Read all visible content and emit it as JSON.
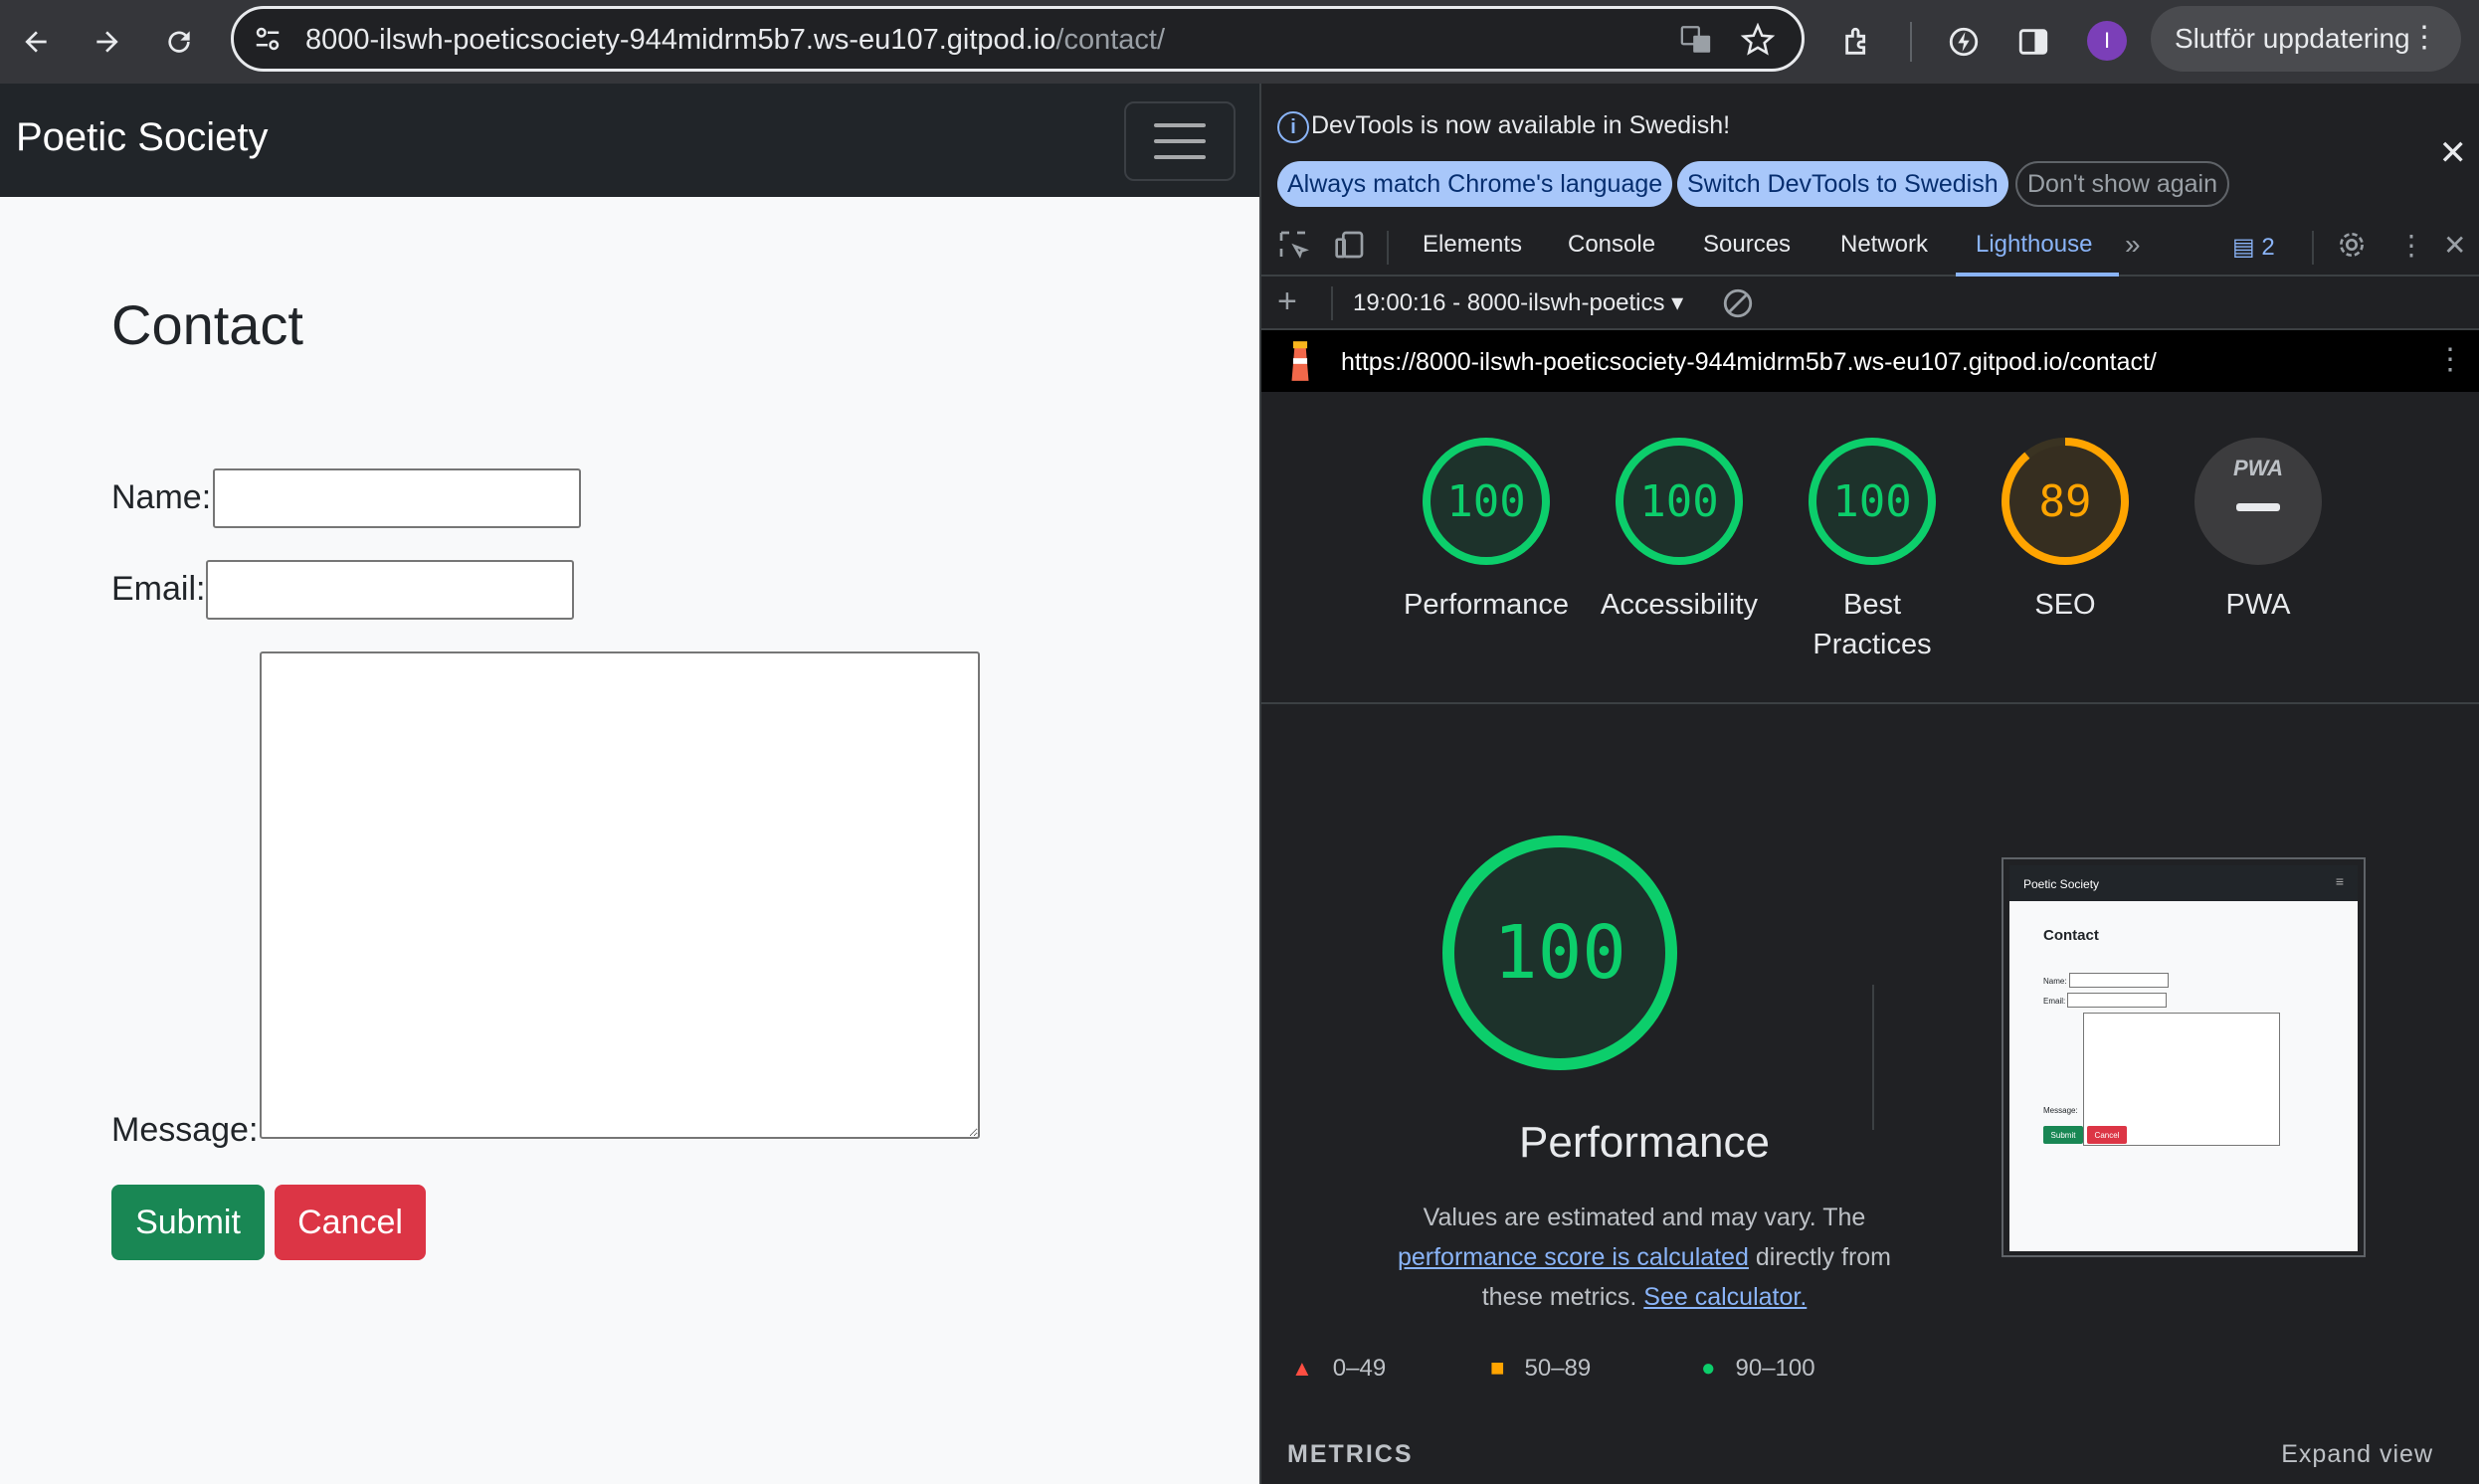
{
  "browser": {
    "url_host": "8000-ilswh-poeticsociety-944midrm5b7.ws-eu107.gitpod.io",
    "url_path": "/contact/",
    "profile_initial": "I",
    "update_button": "Slutför uppdatering"
  },
  "site": {
    "brand": "Poetic Society",
    "page_title": "Contact",
    "form": {
      "name_label": "Name:",
      "email_label": "Email:",
      "message_label": "Message:",
      "name_value": "",
      "email_value": "",
      "message_value": "",
      "submit_label": "Submit",
      "cancel_label": "Cancel"
    }
  },
  "devtools": {
    "infobar": {
      "message": "DevTools is now available in Swedish!",
      "btn_match": "Always match Chrome's language",
      "btn_switch": "Switch DevTools to Swedish",
      "btn_dismiss": "Don't show again"
    },
    "tabs": [
      "Elements",
      "Console",
      "Sources",
      "Network",
      "Lighthouse"
    ],
    "active_tab": "Lighthouse",
    "issues_count": "2",
    "report_select": "19:00:16 - 8000-ilswh-poetics",
    "report_url": "https://8000-ilswh-poeticsociety-944midrm5b7.ws-eu107.gitpod.io/contact/",
    "scores": [
      {
        "label": "Performance",
        "value": "100",
        "color": "#0cce6b"
      },
      {
        "label": "Accessibility",
        "value": "100",
        "color": "#0cce6b"
      },
      {
        "label": "Best",
        "label2": "Practices",
        "value": "100",
        "color": "#0cce6b"
      },
      {
        "label": "SEO",
        "value": "89",
        "color": "#ffa400"
      },
      {
        "label": "PWA",
        "value": "PWA",
        "color": "#5f6368"
      }
    ],
    "main_score": "100",
    "main_title": "Performance",
    "desc_1": "Values are estimated and may vary. The",
    "desc_link1": "performance score is calculated",
    "desc_2": "directly from",
    "desc_3": "these metrics.",
    "desc_link2": "See calculator.",
    "legend": [
      "0–49",
      "50–89",
      "90–100"
    ],
    "metrics_label": "METRICS",
    "expand_label": "Expand view",
    "thumb": {
      "brand": "Poetic Society",
      "title": "Contact",
      "name": "Name:",
      "email": "Email:",
      "message": "Message:",
      "submit": "Submit",
      "cancel": "Cancel"
    }
  }
}
